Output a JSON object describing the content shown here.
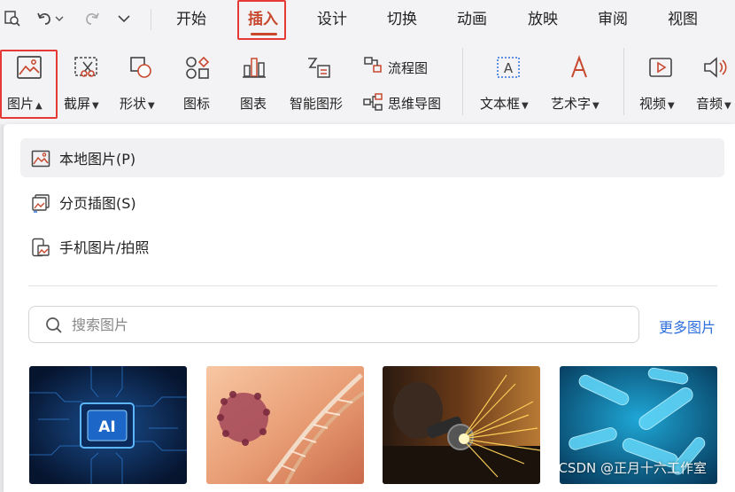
{
  "quick_access": {
    "icons": [
      "search-doc-icon",
      "undo-icon",
      "redo-icon",
      "customize-toolbar-icon"
    ],
    "undo_dropdown_icon": "chevron-down-icon"
  },
  "tabs": [
    {
      "label": "开始"
    },
    {
      "label": "插入",
      "active": true
    },
    {
      "label": "设计"
    },
    {
      "label": "切换"
    },
    {
      "label": "动画"
    },
    {
      "label": "放映"
    },
    {
      "label": "审阅"
    },
    {
      "label": "视图"
    }
  ],
  "ribbon": {
    "picture": "图片",
    "screenshot": "截屏",
    "shape": "形状",
    "icon": "图标",
    "chart": "图表",
    "smartart": "智能图形",
    "flowchart": "流程图",
    "mindmap": "思维导图",
    "textbox": "文本框",
    "wordart": "艺术字",
    "video": "视频",
    "audio": "音频"
  },
  "picture_menu": {
    "items": [
      {
        "label": "本地图片(P)",
        "icon": "local-picture-icon"
      },
      {
        "label": "分页插图(S)",
        "icon": "paged-picture-icon"
      },
      {
        "label": "手机图片/拍照",
        "icon": "phone-picture-icon"
      }
    ],
    "search_placeholder": "搜索图片",
    "more_link": "更多图片",
    "thumbnails": [
      {
        "subject": "AI chip circuit board"
      },
      {
        "subject": "DNA helix and virus"
      },
      {
        "subject": "Metal grinding sparks"
      },
      {
        "subject": "Blue bacteria microscope"
      }
    ]
  },
  "watermark": "CSDN @正月十六工作室",
  "colors": {
    "accent": "#c8482f",
    "highlight_box": "#e53935",
    "link": "#2f6fdc"
  }
}
